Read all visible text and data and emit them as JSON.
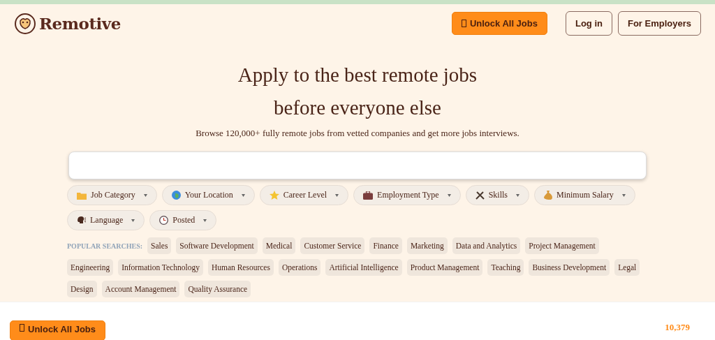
{
  "header": {
    "logo": "Remotive",
    "unlock_button": "Unlock All Jobs",
    "login_button": "Log in",
    "employers_button": "For Employers"
  },
  "hero": {
    "title_line_1": "Apply to the best remote jobs",
    "title_line_2": "before everyone else",
    "subtitle": "Browse 120,000+ fully remote jobs from vetted companies and get more jobs interviews."
  },
  "filters": [
    {
      "label": "Job Category"
    },
    {
      "label": "Your Location"
    },
    {
      "label": "Career Level"
    },
    {
      "label": "Employment Type"
    },
    {
      "label": "Skills"
    },
    {
      "label": "Minimum Salary"
    },
    {
      "label": "Language"
    },
    {
      "label": "Posted"
    }
  ],
  "popular_searches": {
    "label": "POPULAR SEARCHES:",
    "tags": [
      "Sales",
      "Software Development",
      "Medical",
      "Customer Service",
      "Finance",
      "Marketing",
      "Data and Analytics",
      "Project Management",
      "Engineering",
      "Information Technology",
      "Human Resources",
      "Operations",
      "Artificial Intelligence",
      "Product Management",
      "Teaching",
      "Business Development",
      "Legal",
      "Design",
      "Account Management",
      "Quality Assurance"
    ]
  },
  "results": {
    "unlock_button": "Unlock All Jobs",
    "count": "10,379"
  }
}
